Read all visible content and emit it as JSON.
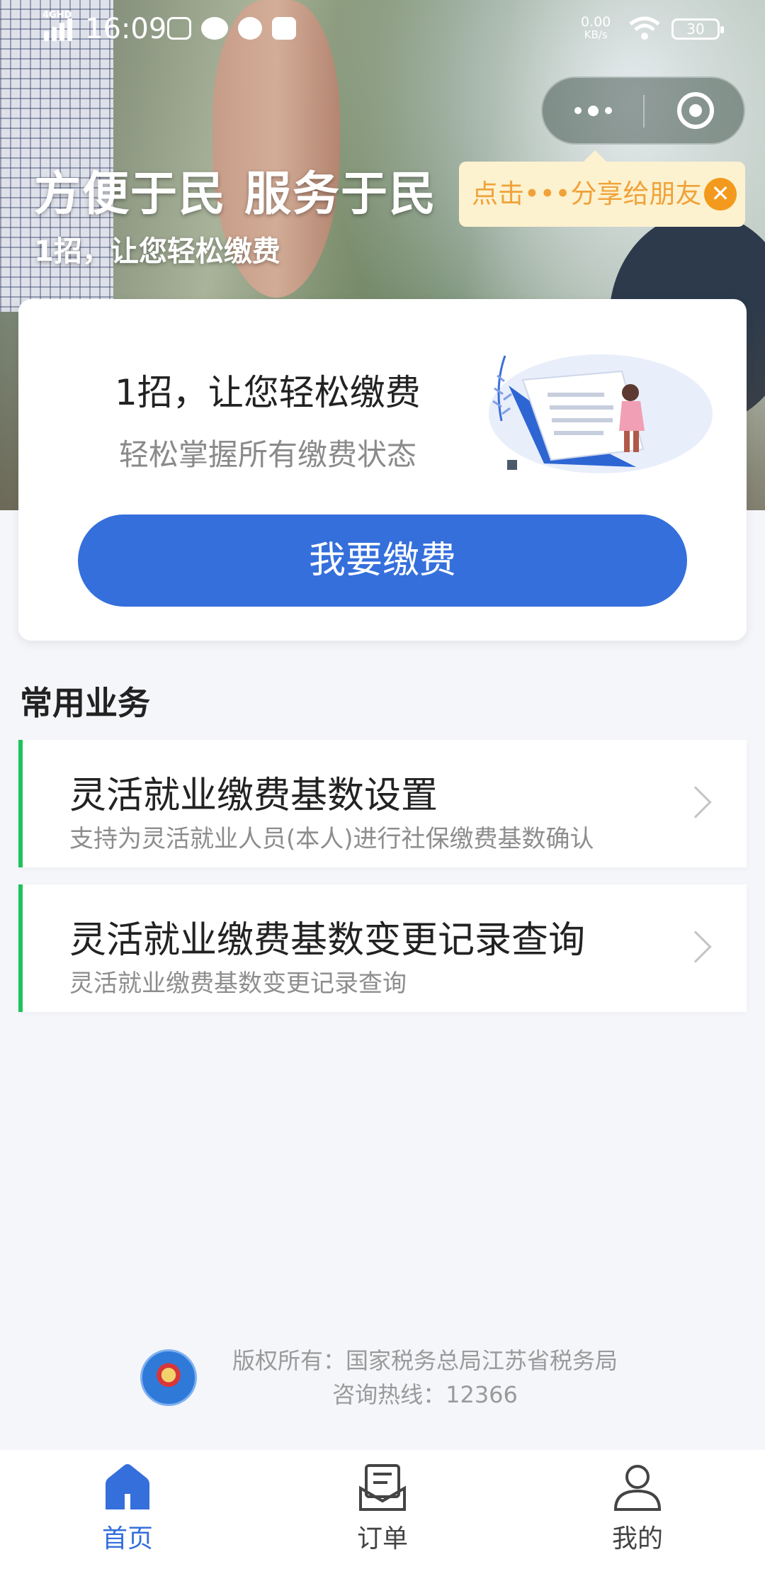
{
  "status_bar": {
    "network": "4GHD",
    "time": "16:09",
    "speed_value": "0.00",
    "speed_unit": "KB/s",
    "battery": "30",
    "notification_icons": [
      "screenshot-icon",
      "wechat-icon",
      "message-icon",
      "k-app-icon"
    ]
  },
  "capsule": {
    "more_icon": "more-dots-icon",
    "close_icon": "target-close-icon"
  },
  "share_tip": {
    "text": "点击•••分享给朋友",
    "close_glyph": "✕"
  },
  "hero": {
    "title": "方便于民 服务于民",
    "subtitle": "1招，让您轻松缴费"
  },
  "card": {
    "title": "1招，让您轻松缴费",
    "subtitle": "轻松掌握所有缴费状态",
    "button_label": "我要缴费",
    "accent_color": "#356fdc"
  },
  "services": {
    "section_title": "常用业务",
    "items": [
      {
        "title": "灵活就业缴费基数设置",
        "desc": "支持为灵活就业人员(本人)进行社保缴费基数确认"
      },
      {
        "title": "灵活就业缴费基数变更记录查询",
        "desc": "灵活就业缴费基数变更记录查询"
      }
    ],
    "marker_color": "#1ec35a"
  },
  "footer": {
    "copyright": "版权所有：国家税务总局江苏省税务局",
    "hotline": "咨询热线：12366"
  },
  "tabbar": {
    "items": [
      {
        "label": "首页",
        "icon": "home-icon",
        "active": true
      },
      {
        "label": "订单",
        "icon": "order-icon",
        "active": false
      },
      {
        "label": "我的",
        "icon": "profile-icon",
        "active": false
      }
    ]
  }
}
